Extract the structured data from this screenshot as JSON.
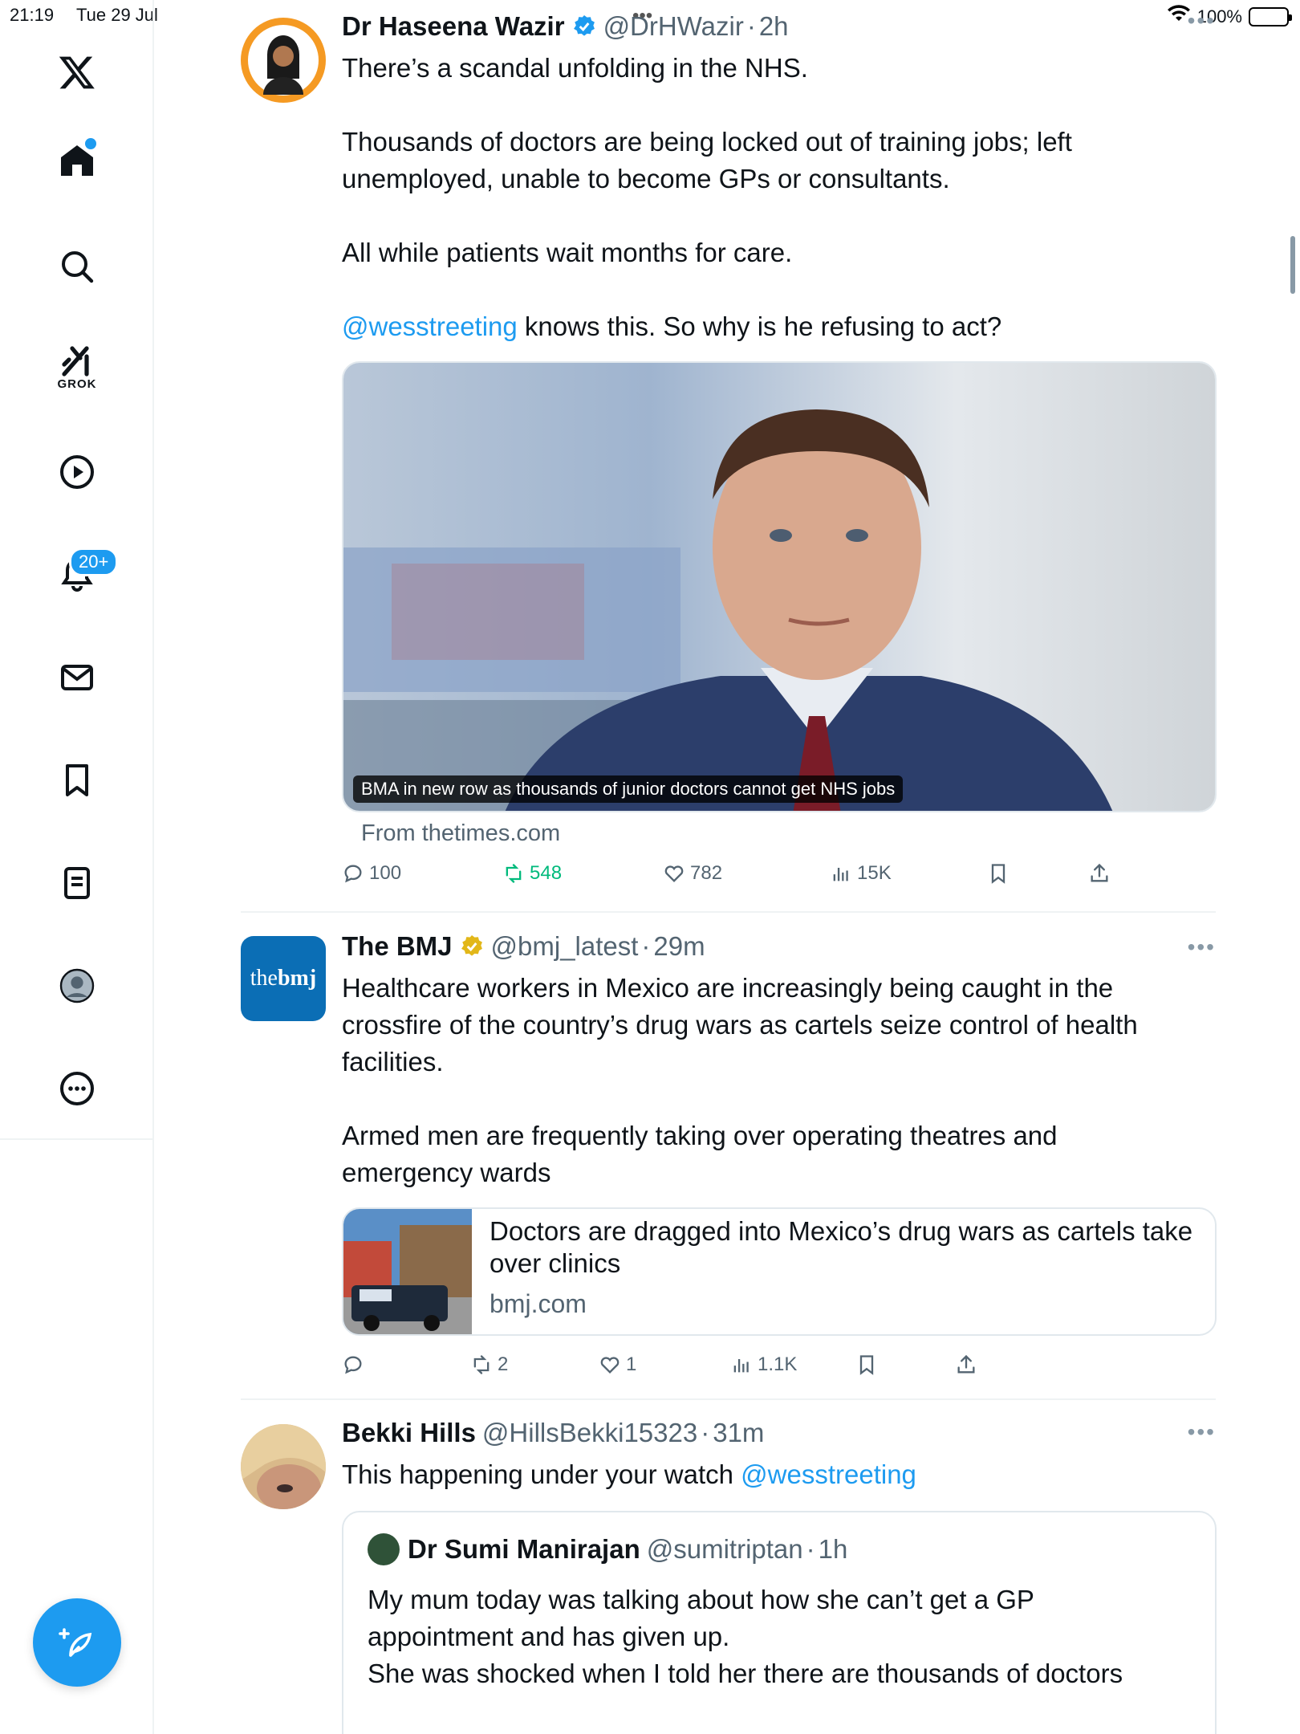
{
  "status_bar": {
    "time": "21:19",
    "date": "Tue 29 Jul",
    "battery": "100%"
  },
  "sidebar": {
    "items": [
      {
        "name": "home"
      },
      {
        "name": "search"
      },
      {
        "name": "grok",
        "label": "GROK"
      },
      {
        "name": "videos"
      },
      {
        "name": "notifications",
        "badge": "20+"
      },
      {
        "name": "messages"
      },
      {
        "name": "bookmarks"
      },
      {
        "name": "lists"
      },
      {
        "name": "profile"
      },
      {
        "name": "more"
      }
    ],
    "accent": "#1d9bf0"
  },
  "tweets": [
    {
      "display_name": "Dr Haseena Wazir",
      "handle": "@DrHWazir",
      "time": "2h",
      "text_p1": "There’s a scandal unfolding in the NHS.",
      "text_p2": "Thousands of doctors are being locked out of training jobs; left unemployed, unable to become GPs or consultants.",
      "text_p3": "All while patients wait months for care.",
      "text_p4_mention": "@wesstreeting",
      "text_p4_rest": " knows this. So why is he refusing to act?",
      "media_caption": "BMA in new row as thousands of junior doctors cannot get NHS jobs",
      "from_source": "From thetimes.com",
      "replies": "100",
      "reposts": "548",
      "likes": "782",
      "views": "15K"
    },
    {
      "display_name": "The BMJ",
      "handle": "@bmj_latest",
      "time": "29m",
      "avatar_text_a": "the",
      "avatar_text_b": "bmj",
      "text_p1": "Healthcare workers in Mexico are increasingly being caught in the crossfire of the country’s drug wars as cartels seize control of health facilities.",
      "text_p2": "Armed men are frequently taking over operating theatres and emergency wards",
      "link_title": "Doctors are dragged into Mexico’s drug wars as cartels take over clinics",
      "link_domain": "bmj.com",
      "replies": "",
      "reposts": "2",
      "likes": "1",
      "views": "1.1K"
    },
    {
      "display_name": "Bekki Hills",
      "handle": "@HillsBekki15323",
      "time": "31m",
      "text_start": "This happening under your watch ",
      "text_mention": "@wesstreeting",
      "quote": {
        "display_name": "Dr Sumi Manirajan",
        "handle": "@sumitriptan",
        "time": "1h",
        "text_p1": "My mum today was talking about how she can’t get a GP appointment and has given up.",
        "text_p2": "She was shocked when I told her there are thousands of doctors"
      }
    }
  ]
}
